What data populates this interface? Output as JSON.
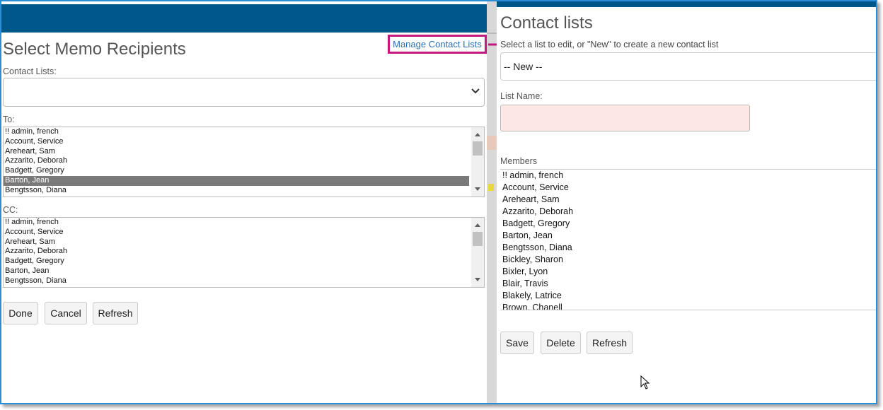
{
  "left_panel": {
    "title": "Select Memo Recipients",
    "manage_link": "Manage Contact Lists",
    "contact_lists_label": "Contact Lists:",
    "contact_lists_value": "",
    "to_label": "To:",
    "to_items": [
      "!! admin, french",
      "Account, Service",
      "Areheart, Sam",
      "Azzarito, Deborah",
      "Badgett, Gregory",
      "Barton, Jean",
      "Bengtsson, Diana"
    ],
    "to_selected": "Barton, Jean",
    "cc_label": "CC:",
    "cc_items": [
      "!! admin, french",
      "Account, Service",
      "Areheart, Sam",
      "Azzarito, Deborah",
      "Badgett, Gregory",
      "Barton, Jean",
      "Bengtsson, Diana"
    ],
    "buttons": {
      "done": "Done",
      "cancel": "Cancel",
      "refresh": "Refresh"
    }
  },
  "right_panel": {
    "title": "Contact lists",
    "subtitle": "Select a list to edit, or \"New\" to create a new contact list",
    "select_value": "-- New --",
    "list_name_label": "List Name:",
    "list_name_value": "",
    "members_label": "Members",
    "members": [
      "!! admin, french",
      "Account, Service",
      "Areheart, Sam",
      "Azzarito, Deborah",
      "Badgett, Gregory",
      "Barton, Jean",
      "Bengtsson, Diana",
      "Bickley, Sharon",
      "Bixler, Lyon",
      "Blair, Travis",
      "Blakely, Latrice",
      "Brown, Chanell"
    ],
    "buttons": {
      "save": "Save",
      "delete": "Delete",
      "refresh": "Refresh"
    }
  },
  "colors": {
    "header_blue": "#00578a",
    "frame_blue": "#2a8fd6",
    "highlight_magenta": "#c2187f",
    "invalid_input": "#fde7e4",
    "selected_row": "#7a7a7a"
  }
}
